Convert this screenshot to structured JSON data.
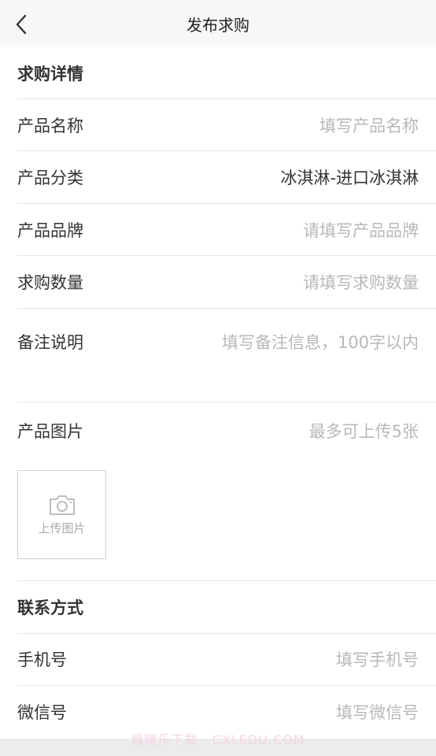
{
  "nav": {
    "title": "发布求购"
  },
  "detail_section": {
    "title": "求购详情"
  },
  "fields": [
    {
      "label": "产品名称",
      "value": "填写产品名称",
      "filled": false
    },
    {
      "label": "产品分类",
      "value": "冰淇淋-进口冰淇淋",
      "filled": true
    },
    {
      "label": "产品品牌",
      "value": "请填写产品品牌",
      "filled": false
    },
    {
      "label": "求购数量",
      "value": "请填写求购数量",
      "filled": false
    },
    {
      "label": "备注说明",
      "value": "填写备注信息，100字以内",
      "filled": false
    }
  ],
  "images": {
    "label": "产品图片",
    "hint": "最多可上传5张",
    "upload_label": "上传图片"
  },
  "contact_section": {
    "title": "联系方式"
  },
  "contact_fields": [
    {
      "label": "手机号",
      "value": "填写手机号"
    },
    {
      "label": "微信号",
      "value": "填写微信号"
    }
  ],
  "watermark": "晨曦乐下载 · CXLEDU.COM"
}
